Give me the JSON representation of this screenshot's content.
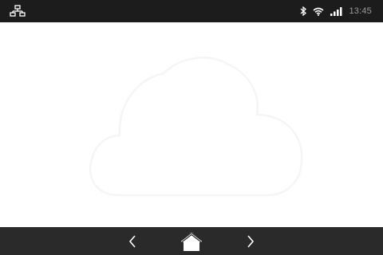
{
  "status_bar": {
    "network_icon": "ethernet-network-icon",
    "bluetooth_icon": "bluetooth-icon",
    "wifi_icon": "wifi-icon",
    "signal_icon": "signal-bars-icon",
    "time": "13:45"
  },
  "content": {
    "graphic_icon": "cloud-icon"
  },
  "nav_bar": {
    "back_icon": "chevron-left-icon",
    "home_icon": "home-icon",
    "forward_icon": "chevron-right-icon"
  },
  "colors": {
    "status_bar_bg": "#1c1c1c",
    "nav_bar_bg": "#2a2a2a",
    "content_bg": "#ffffff",
    "icon_color": "#ffffff",
    "time_color": "#9a9a9a"
  }
}
